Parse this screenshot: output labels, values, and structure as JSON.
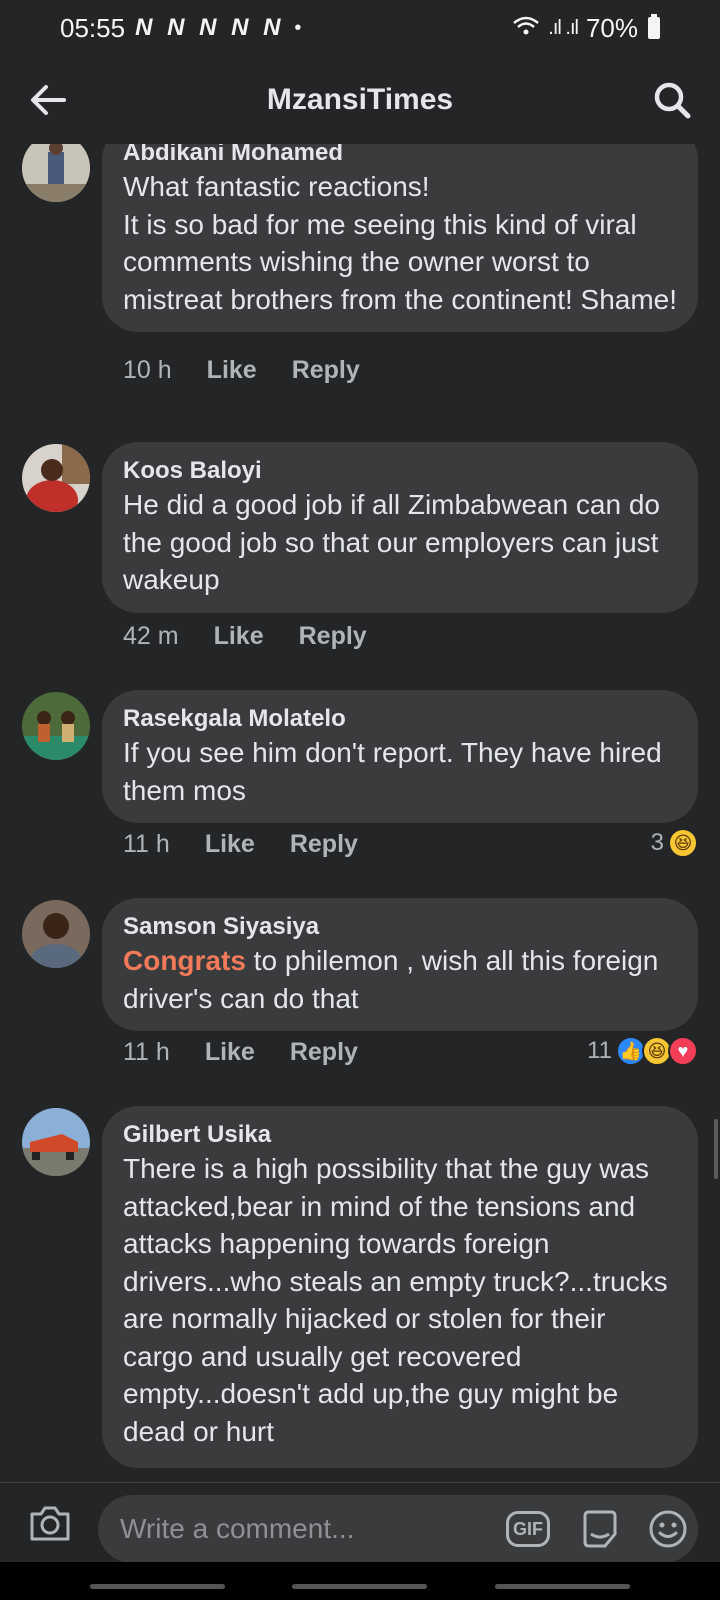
{
  "status_bar": {
    "time": "05:55",
    "notification_icons": "N N N N N",
    "dot": "•",
    "signal": ".ıl .ıl",
    "battery": "70%"
  },
  "header": {
    "title": "MzansiTimes"
  },
  "comments": [
    {
      "author": "Abdikani Mohamed",
      "text": "What fantastic reactions!\nIt is so bad for me seeing this kind of viral comments wishing the owner worst to mistreat brothers from the continent! Shame!",
      "time": "10 h",
      "like_label": "Like",
      "reply_label": "Reply",
      "avatar_color": "#8a8276"
    },
    {
      "author": "Koos Baloyi",
      "text": "He did a good job if all Zimbabwean can do the good job so that our employers can just wakeup",
      "time": "42 m",
      "like_label": "Like",
      "reply_label": "Reply",
      "avatar_color": "#b8302c"
    },
    {
      "author": "Rasekgala Molatelo",
      "text": "If you see him don't report. They have hired them mos",
      "time": "11 h",
      "like_label": "Like",
      "reply_label": "Reply",
      "reaction_count": "3",
      "avatar_color": "#5f7a4a"
    },
    {
      "author": "Samson Siyasiya",
      "highlight": "Congrats",
      "text": " to philemon , wish all this foreign driver's can do that",
      "time": "11 h",
      "like_label": "Like",
      "reply_label": "Reply",
      "reaction_count": "11",
      "avatar_color": "#5a4a40"
    },
    {
      "author": "Gilbert Usika",
      "text": "There is a high possibility that the guy was attacked,bear in mind of the tensions and attacks happening towards foreign drivers...who steals an empty truck?...trucks are normally hijacked or stolen for their cargo and usually get recovered empty...doesn't add up,the guy might be dead or hurt",
      "avatar_color": "#6f8fb0"
    }
  ],
  "composer": {
    "placeholder": "Write a comment...",
    "gif_label": "GIF"
  },
  "colors": {
    "background": "#242526",
    "bubble": "#3a3b3c",
    "highlight": "#f07a5a"
  }
}
